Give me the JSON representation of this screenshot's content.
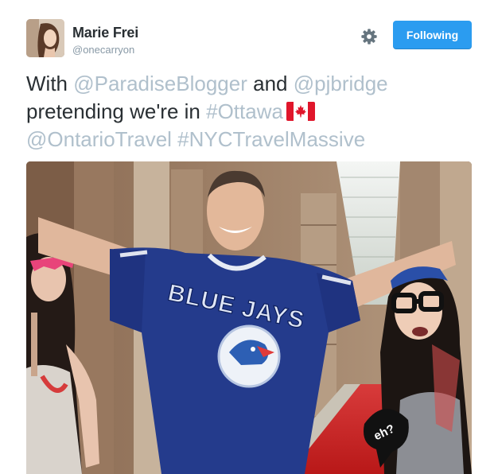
{
  "author": {
    "name": "Marie Frei",
    "handle": "@onecarryon",
    "avatar_icon": "avatar-photo"
  },
  "actions": {
    "settings_icon": "gear-icon",
    "follow_label": "Following",
    "follow_color": "#2b9cf0"
  },
  "tweet": {
    "word_with": "With",
    "mention_1": "@ParadiseBlogger",
    "word_and": "and",
    "mention_2": "@pjbridge",
    "phrase": "pretending we're in",
    "hashtag_1": "#Ottawa",
    "flag_icon": "canada-flag-icon",
    "mention_3": "@OntarioTravel",
    "hashtag_2": "#NYCTravelMassive",
    "link_color": "#b0c0cc"
  },
  "photo": {
    "jersey_text": "BLUE JAYS",
    "sign_text": "eh?"
  }
}
